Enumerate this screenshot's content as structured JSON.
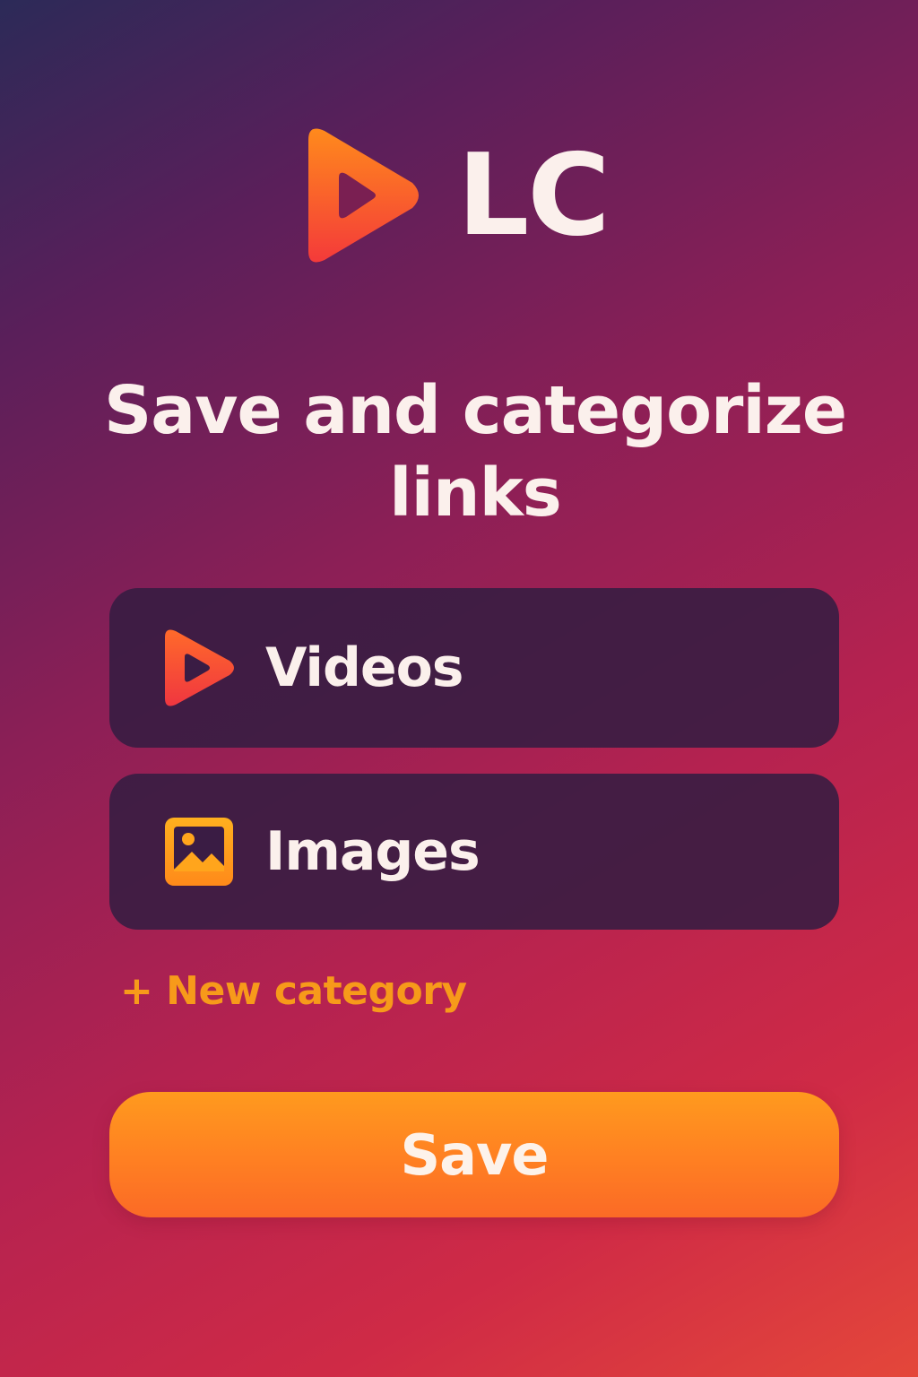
{
  "app": {
    "logo_text": "LC",
    "logo_icon": "play-icon"
  },
  "headline": {
    "line1": "Save and categorize",
    "line2": "links"
  },
  "categories": [
    {
      "label": "Videos",
      "icon": "play-icon"
    },
    {
      "label": "Images",
      "icon": "image-icon"
    }
  ],
  "actions": {
    "new_category": "+ New category",
    "save": "Save"
  },
  "colors": {
    "accent_orange": "#f79a1a",
    "card_bg": "#341c42",
    "text_light": "#fbf0ec",
    "play_red": "#f43a3a"
  }
}
